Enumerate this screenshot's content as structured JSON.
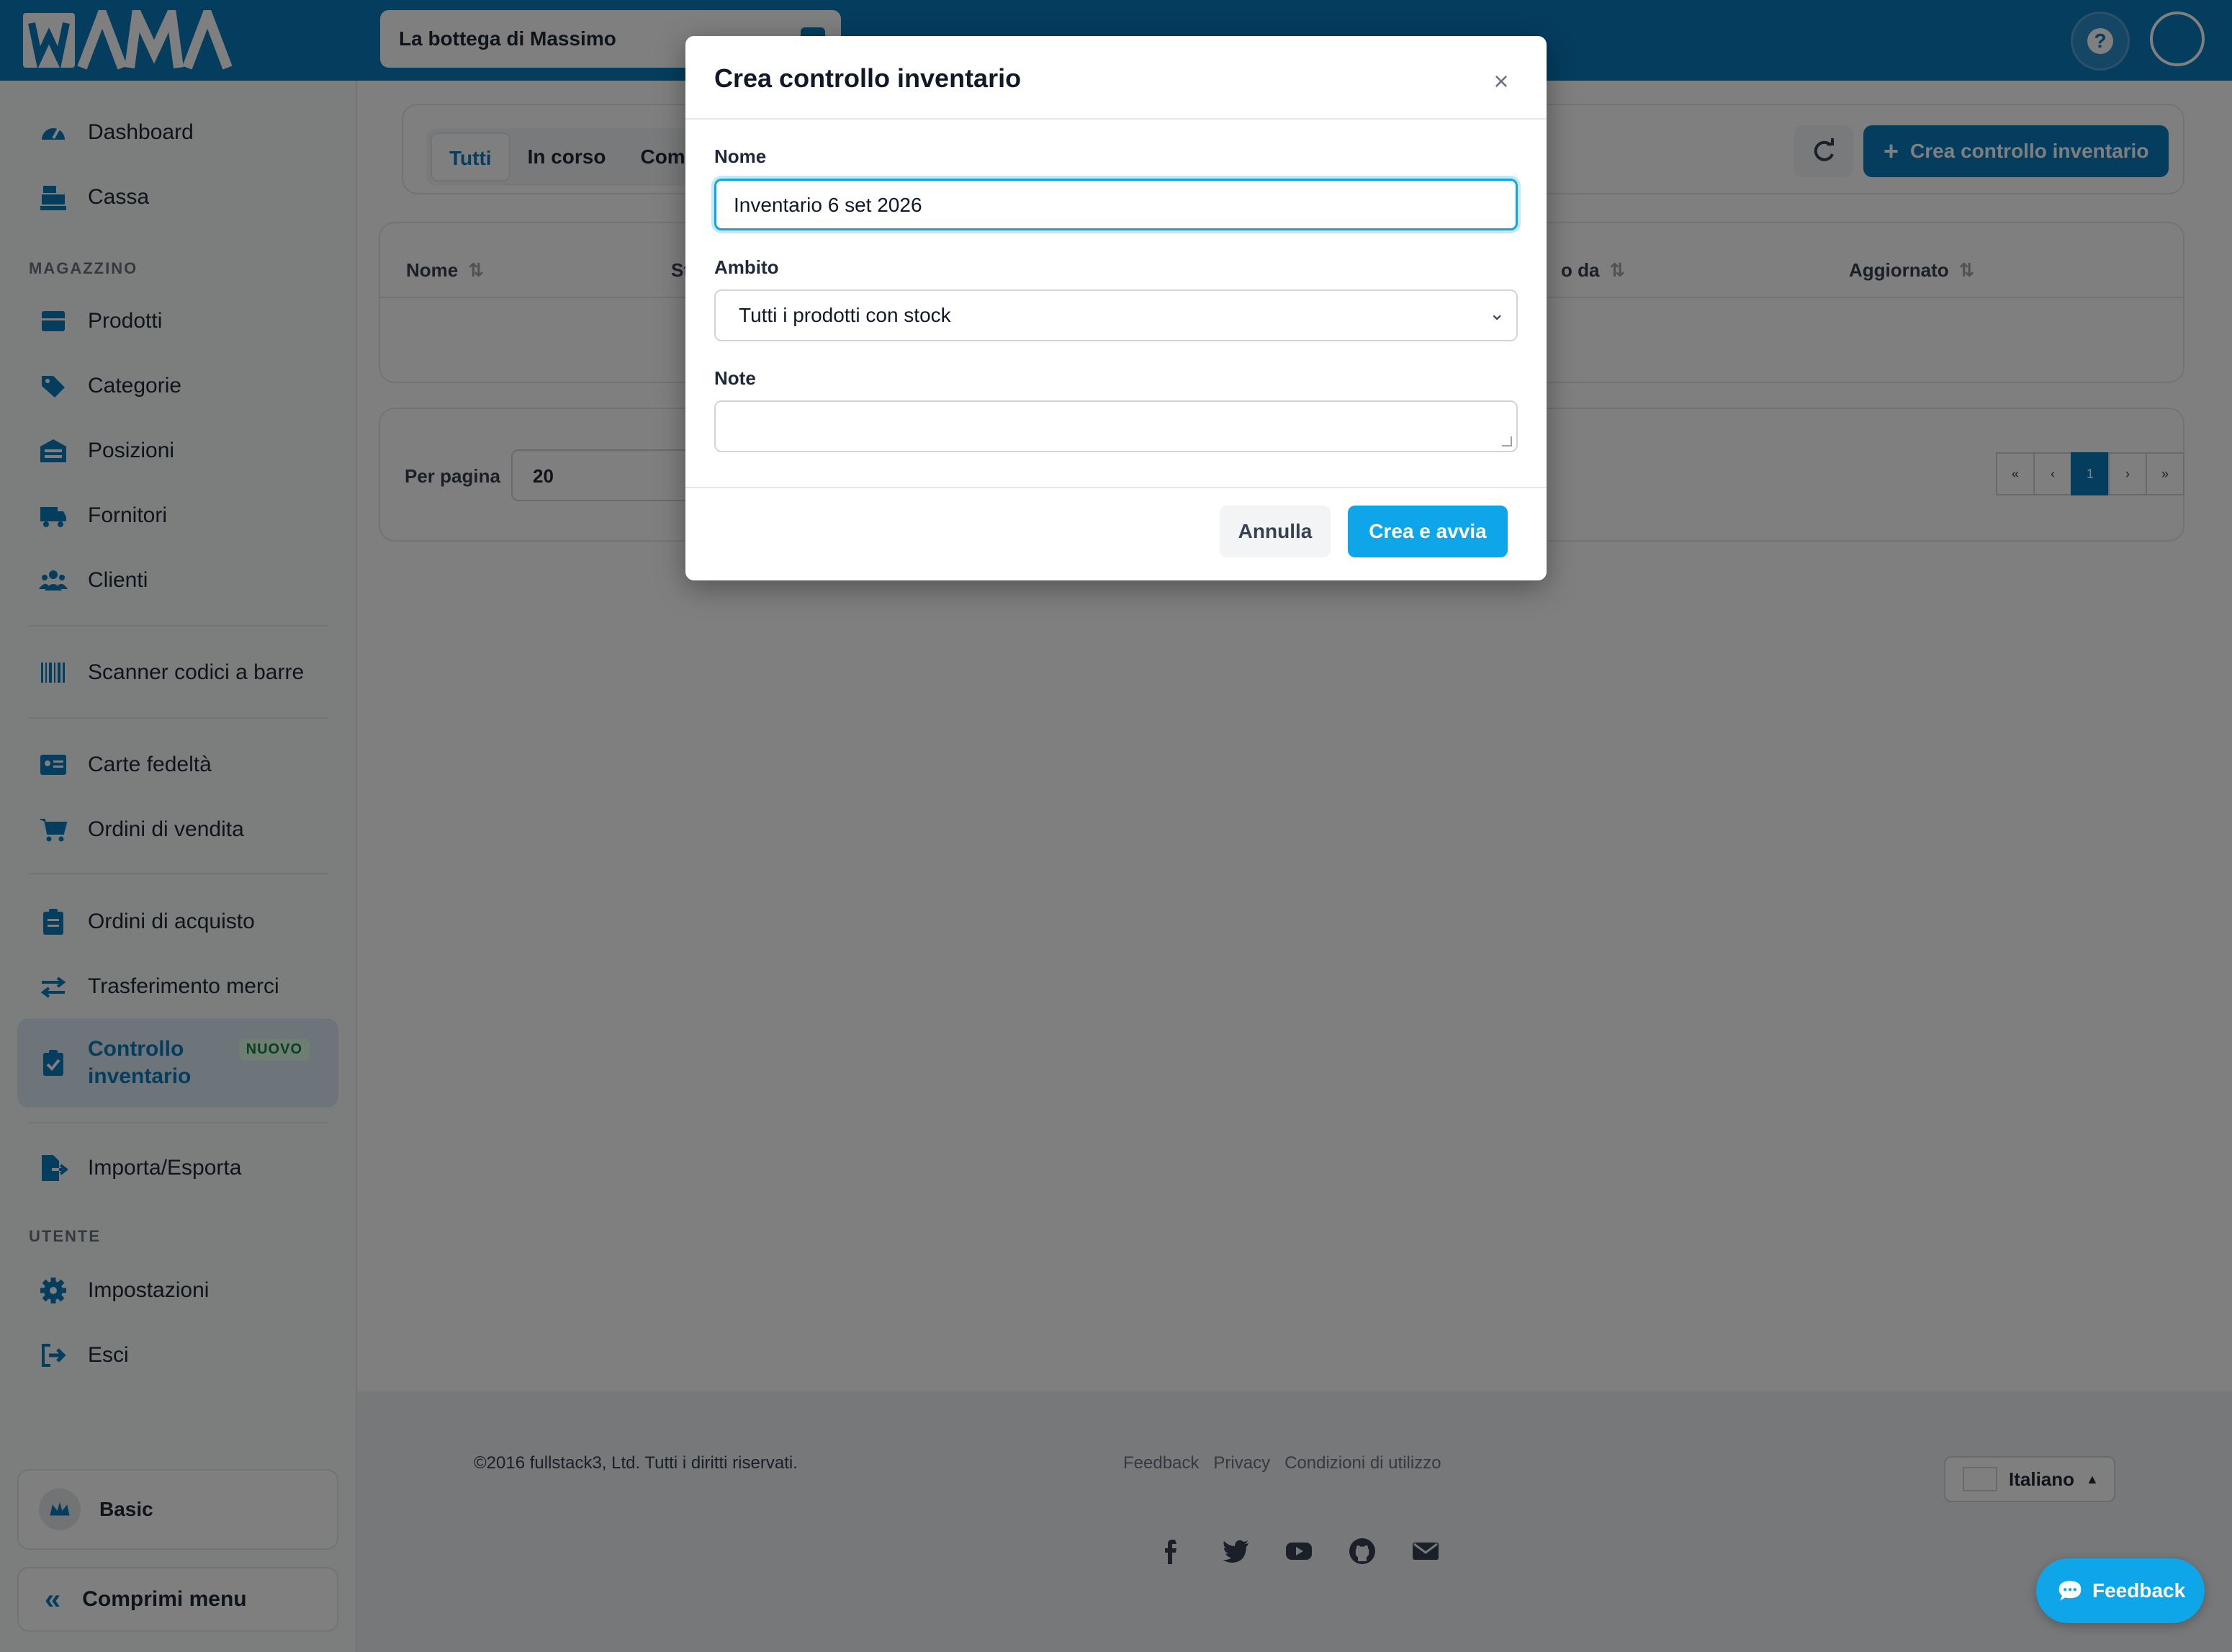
{
  "header": {
    "logo_text": "WAMA",
    "store_name": "La bottega di Massimo",
    "help_icon": "question-circle-icon"
  },
  "sidebar": {
    "items_top": [
      {
        "id": "dashboard",
        "label": "Dashboard",
        "icon": "gauge-icon"
      },
      {
        "id": "cassa",
        "label": "Cassa",
        "icon": "cash-register-icon"
      }
    ],
    "section_magazzino": "MAGAZZINO",
    "items_magazzino": [
      {
        "id": "prodotti",
        "label": "Prodotti",
        "icon": "box-icon"
      },
      {
        "id": "categorie",
        "label": "Categorie",
        "icon": "tags-icon"
      },
      {
        "id": "posizioni",
        "label": "Posizioni",
        "icon": "warehouse-icon"
      },
      {
        "id": "fornitori",
        "label": "Fornitori",
        "icon": "truck-icon"
      },
      {
        "id": "clienti",
        "label": "Clienti",
        "icon": "users-icon"
      }
    ],
    "scanner": {
      "label": "Scanner codici a barre",
      "icon": "barcode-icon"
    },
    "items_sales": [
      {
        "id": "carte",
        "label": "Carte fedeltà",
        "icon": "id-card-icon"
      },
      {
        "id": "ordini-vendita",
        "label": "Ordini di vendita",
        "icon": "cart-icon"
      }
    ],
    "items_purchase": [
      {
        "id": "ordini-acquisto",
        "label": "Ordini di acquisto",
        "icon": "clipboard-icon"
      },
      {
        "id": "trasferimento",
        "label": "Trasferimento merci",
        "icon": "exchange-icon"
      }
    ],
    "active_item": {
      "label": "Controllo inventario",
      "badge": "NUOVO",
      "icon": "clipboard-check-icon"
    },
    "import_export": {
      "label": "Importa/Esporta",
      "icon": "file-export-icon"
    },
    "section_utente": "UTENTE",
    "items_user": [
      {
        "id": "impostazioni",
        "label": "Impostazioni",
        "icon": "gear-icon"
      },
      {
        "id": "esci",
        "label": "Esci",
        "icon": "sign-out-icon"
      }
    ],
    "plan_label": "Basic",
    "collapse_label": "Comprimi menu",
    "collapse_glyph": "«"
  },
  "main": {
    "tabs": [
      "Tutti",
      "In corso",
      "Comp"
    ],
    "active_tab": "Tutti",
    "create_button": "Crea controllo inventario",
    "columns": [
      "Nome",
      "St",
      "o da",
      "Aggiornato"
    ],
    "per_page_label": "Per pagina",
    "per_page_value": "20",
    "pager": [
      "«",
      "‹",
      "1",
      "›",
      "»"
    ],
    "current_page": "1"
  },
  "footer": {
    "copyright": "©2016 fullstack3, Ltd. Tutti i diritti riservati.",
    "links": [
      "Feedback",
      "Privacy",
      "Condizioni di utilizzo"
    ],
    "language": "Italiano",
    "socials": [
      "facebook-icon",
      "twitter-icon",
      "youtube-icon",
      "github-icon",
      "envelope-icon"
    ]
  },
  "modal": {
    "title": "Crea controllo inventario",
    "close_glyph": "×",
    "name_label": "Nome",
    "name_value": "Inventario 6 set 2026",
    "scope_label": "Ambito",
    "scope_value": "Tutti i prodotti con stock",
    "notes_label": "Note",
    "notes_value": "",
    "cancel_label": "Annulla",
    "submit_label": "Crea e avvia"
  },
  "feedback_button": "Feedback",
  "colors": {
    "brand": "#0a7bbf",
    "accent": "#0ea5e9",
    "badge_green": "#15803d"
  }
}
